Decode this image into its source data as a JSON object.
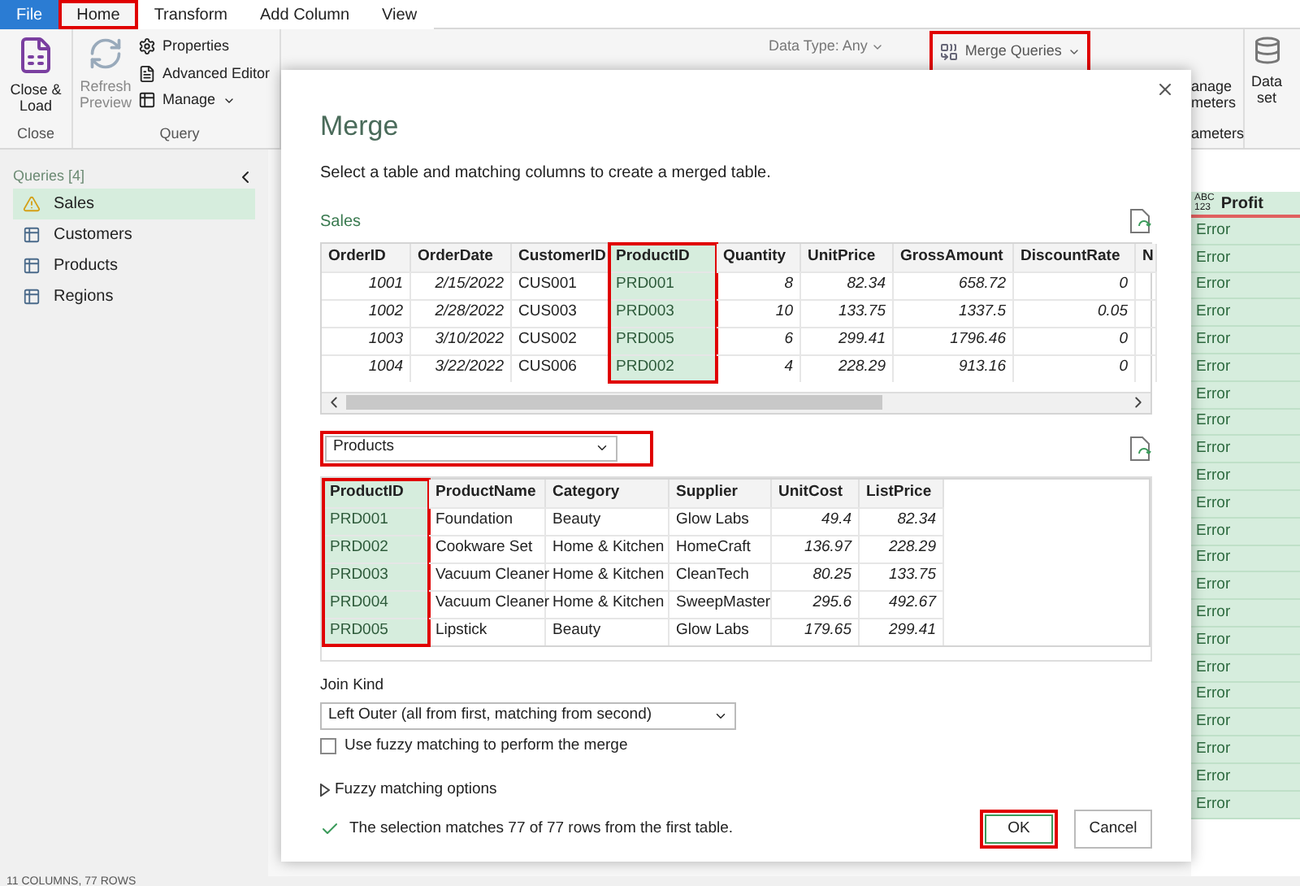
{
  "ribbon_tabs": [
    {
      "label": "File",
      "kind": "file",
      "selected": false,
      "highlighted": false
    },
    {
      "label": "Home",
      "kind": "tab",
      "selected": true,
      "highlighted": true
    },
    {
      "label": "Transform",
      "kind": "tab",
      "selected": false,
      "highlighted": false
    },
    {
      "label": "Add Column",
      "kind": "tab",
      "selected": false,
      "highlighted": false
    },
    {
      "label": "View",
      "kind": "tab",
      "selected": false,
      "highlighted": false
    }
  ],
  "ribbon": {
    "close_group": {
      "button": "Close &\nLoad",
      "label": "Close"
    },
    "query_group": {
      "refresh": "Refresh\nPreview",
      "properties": "Properties",
      "advanced_editor": "Advanced Editor",
      "manage": "Manage",
      "label": "Query"
    },
    "data_type": "Data Type: Any",
    "merge_queries": {
      "label": "Merge Queries",
      "highlighted": true
    },
    "parameters": {
      "button": "anage\nmeters",
      "label": "ameters"
    },
    "data_source": {
      "button": "Data\nset"
    }
  },
  "queries_panel": {
    "title": "Queries [4]",
    "items": [
      {
        "name": "Sales",
        "kind": "warning",
        "selected": true
      },
      {
        "name": "Customers",
        "kind": "table",
        "selected": false
      },
      {
        "name": "Products",
        "kind": "table",
        "selected": false
      },
      {
        "name": "Regions",
        "kind": "table",
        "selected": false
      }
    ]
  },
  "data_column": {
    "header": "Profit",
    "type_label": "ABC\n123",
    "cells": [
      "Error",
      "Error",
      "Error",
      "Error",
      "Error",
      "Error",
      "Error",
      "Error",
      "Error",
      "Error",
      "Error",
      "Error",
      "Error",
      "Error",
      "Error",
      "Error",
      "Error",
      "Error",
      "Error",
      "Error",
      "Error",
      "Error"
    ]
  },
  "status_bar": "11 COLUMNS, 77 ROWS",
  "dialog": {
    "title": "Merge",
    "subtitle": "Select a table and matching columns to create a merged table.",
    "first_table": {
      "name": "Sales",
      "columns": [
        {
          "name": "OrderID",
          "kind": "number",
          "selected": false
        },
        {
          "name": "OrderDate",
          "kind": "number",
          "selected": false
        },
        {
          "name": "CustomerID",
          "kind": "text",
          "selected": false
        },
        {
          "name": "ProductID",
          "kind": "text",
          "selected": true
        },
        {
          "name": "Quantity",
          "kind": "number",
          "selected": false
        },
        {
          "name": "UnitPrice",
          "kind": "number",
          "selected": false
        },
        {
          "name": "GrossAmount",
          "kind": "number",
          "selected": false
        },
        {
          "name": "DiscountRate",
          "kind": "number",
          "selected": false
        },
        {
          "name": "N",
          "kind": "text",
          "selected": false
        }
      ],
      "rows": [
        [
          "1001",
          "2/15/2022",
          "CUS001",
          "PRD001",
          "8",
          "82.34",
          "658.72",
          "0",
          ""
        ],
        [
          "1002",
          "2/28/2022",
          "CUS003",
          "PRD003",
          "10",
          "133.75",
          "1337.5",
          "0.05",
          ""
        ],
        [
          "1003",
          "3/10/2022",
          "CUS002",
          "PRD005",
          "6",
          "299.41",
          "1796.46",
          "0",
          ""
        ],
        [
          "1004",
          "3/22/2022",
          "CUS006",
          "PRD002",
          "4",
          "228.29",
          "913.16",
          "0",
          ""
        ]
      ]
    },
    "second_table_select": {
      "value": "Products",
      "highlighted": true
    },
    "second_table": {
      "columns": [
        {
          "name": "ProductID",
          "kind": "text",
          "selected": true
        },
        {
          "name": "ProductName",
          "kind": "text",
          "selected": false
        },
        {
          "name": "Category",
          "kind": "text",
          "selected": false
        },
        {
          "name": "Supplier",
          "kind": "text",
          "selected": false
        },
        {
          "name": "UnitCost",
          "kind": "number",
          "selected": false
        },
        {
          "name": "ListPrice",
          "kind": "number",
          "selected": false
        }
      ],
      "rows": [
        [
          "PRD001",
          "Foundation",
          "Beauty",
          "Glow Labs",
          "49.4",
          "82.34"
        ],
        [
          "PRD002",
          "Cookware Set",
          "Home & Kitchen",
          "HomeCraft",
          "136.97",
          "228.29"
        ],
        [
          "PRD003",
          "Vacuum Cleaner",
          "Home & Kitchen",
          "CleanTech",
          "80.25",
          "133.75"
        ],
        [
          "PRD004",
          "Vacuum Cleaner",
          "Home & Kitchen",
          "SweepMaster",
          "295.6",
          "492.67"
        ],
        [
          "PRD005",
          "Lipstick",
          "Beauty",
          "Glow Labs",
          "179.65",
          "299.41"
        ]
      ]
    },
    "join_kind": {
      "label": "Join Kind",
      "value": "Left Outer (all from first, matching from second)"
    },
    "fuzzy_checkbox": {
      "label": "Use fuzzy matching to perform the merge",
      "checked": false
    },
    "fuzzy_options": {
      "label": "Fuzzy matching options",
      "expanded": false
    },
    "status": {
      "text": "The selection matches 77 of 77 rows from the first table.",
      "ok": true
    },
    "buttons": [
      {
        "label": "OK",
        "kind": "primary",
        "highlighted": true
      },
      {
        "label": "Cancel",
        "kind": "secondary",
        "highlighted": false
      }
    ]
  }
}
